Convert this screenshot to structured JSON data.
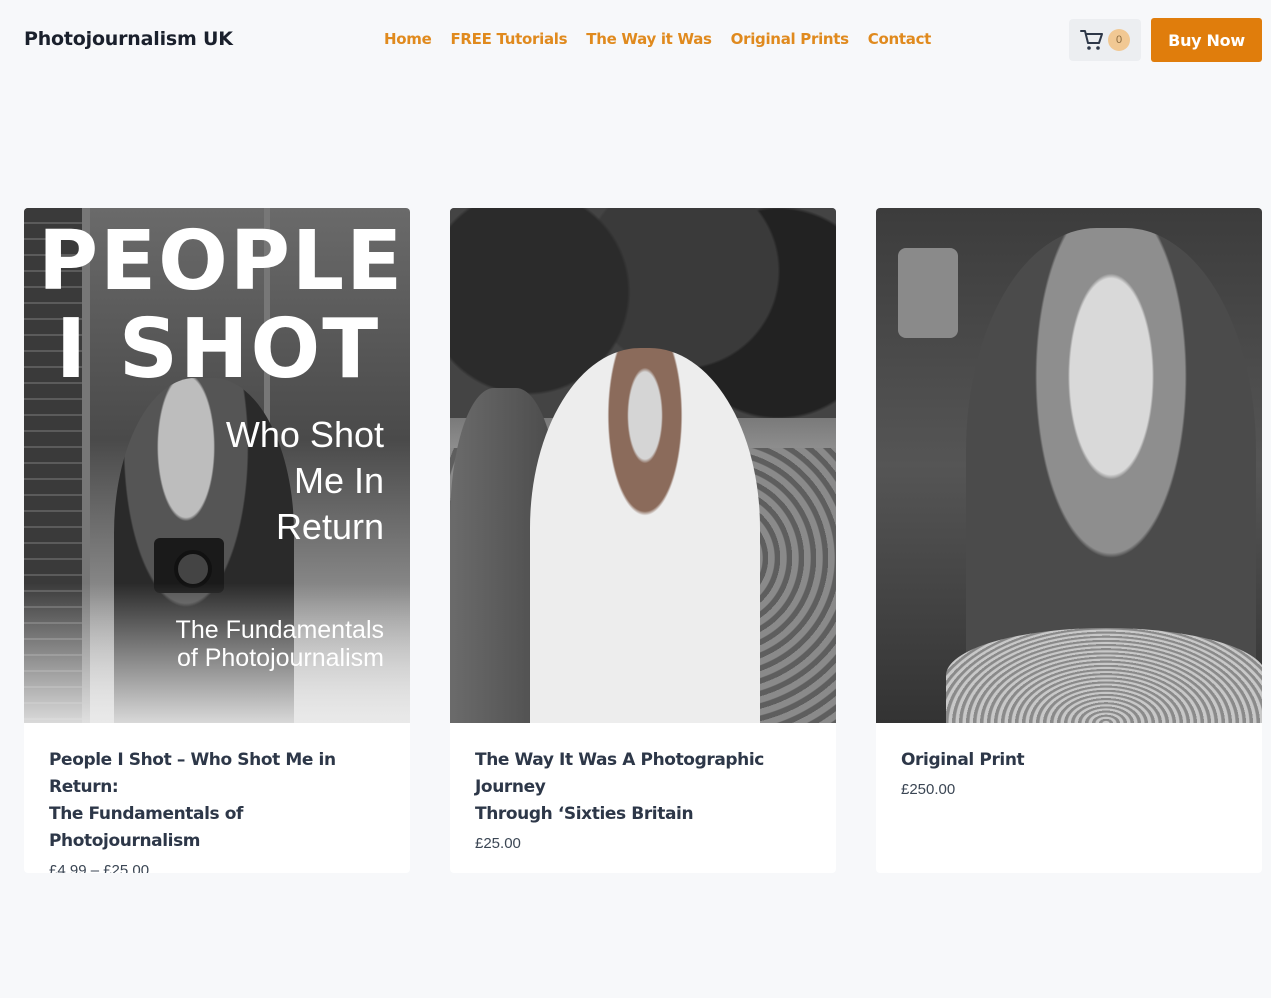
{
  "site_title": "Photojournalism UK",
  "nav": [
    "Home",
    "FREE Tutorials",
    "The Way it Was",
    "Original Prints",
    "Contact"
  ],
  "cart": {
    "count": "0",
    "icon": "cart-icon"
  },
  "buy_button": "Buy Now",
  "colors": {
    "accent": "#e07d0c",
    "nav_link": "#e08a1e",
    "background": "#f7f8fa"
  },
  "products": [
    {
      "cover": {
        "line1": "PEOPLE",
        "line2": "I SHOT",
        "sub1": "Who Shot",
        "sub2": "Me In",
        "sub3": "Return",
        "foot1": "The Fundamentals",
        "foot2": "of Photojournalism"
      },
      "title_line1": "People I Shot – Who Shot Me in Return:",
      "title_line2": "The Fundamentals of Photojournalism",
      "price": "£4.99 – £25.00"
    },
    {
      "title_line1": "The Way It Was A Photographic Journey",
      "title_line2": "Through ‘Sixties Britain",
      "price": "£25.00"
    },
    {
      "title_line1": "Original Print",
      "title_line2": "",
      "price": "£250.00"
    }
  ]
}
